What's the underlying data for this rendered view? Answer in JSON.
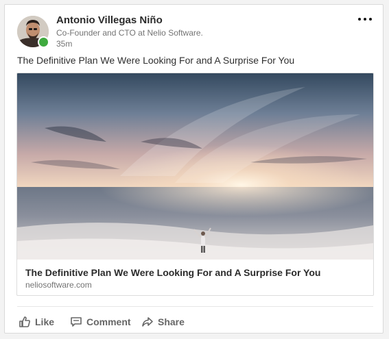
{
  "author": {
    "name": "Antonio Villegas Niño",
    "title": "Co-Founder and CTO at Nelio Software.",
    "time": "35m",
    "presence_color": "#3faa3f"
  },
  "post": {
    "text": "The Definitive Plan We Were Looking For and A Surprise For You"
  },
  "link_preview": {
    "title": "The Definitive Plan We Were Looking For and A Surprise For You",
    "domain": "neliosoftware.com"
  },
  "actions": {
    "like": "Like",
    "comment": "Comment",
    "share": "Share"
  },
  "icons": {
    "more": "more-horizontal-icon",
    "like": "thumbs-up-icon",
    "comment": "comment-bubble-icon",
    "share": "share-arrow-icon"
  }
}
